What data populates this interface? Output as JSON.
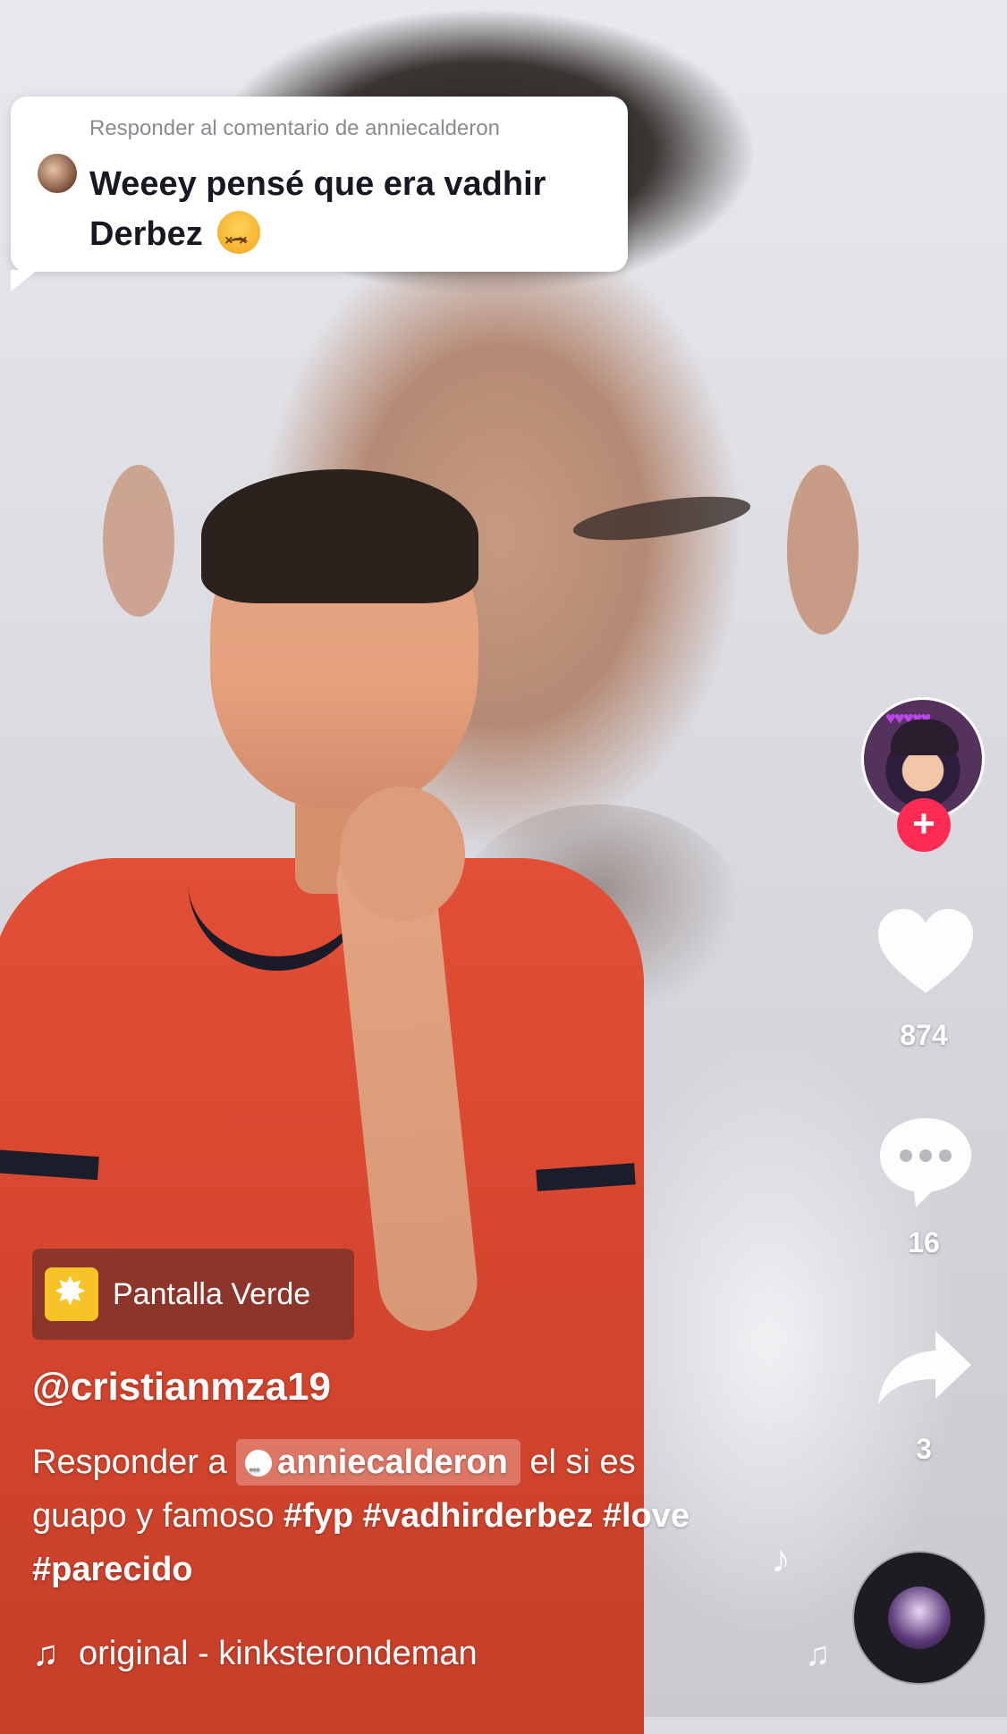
{
  "reply": {
    "header": "Responder al comentario de anniecalderon",
    "text": "Weeey pensé que era vadhir Derbez",
    "emoji": "dizzy-face-emoji"
  },
  "actions": {
    "like_count": "874",
    "comment_count": "16",
    "share_count": "3"
  },
  "effect": {
    "label": "Pantalla Verde",
    "icon": "sparkle-effect-icon"
  },
  "post": {
    "username": "@cristianmza19",
    "caption_prefix": "Responder a",
    "mention": "anniecalderon",
    "caption_rest": "el si es guapo y famoso",
    "hashtags": [
      "#fyp",
      "#vadhirderbez",
      "#love",
      "#parecido"
    ]
  },
  "music": {
    "text": "original - kinksterondeman"
  },
  "colors": {
    "follow_button": "#fe2c55",
    "effect_icon": "#f7c428"
  }
}
